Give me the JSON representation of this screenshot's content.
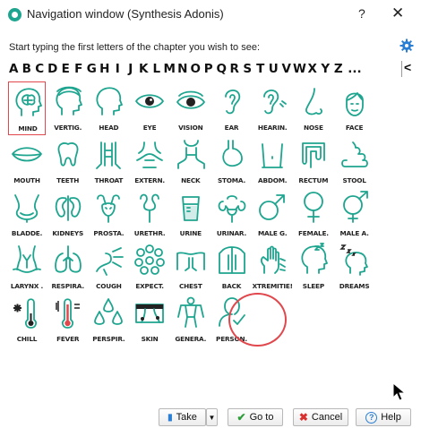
{
  "window": {
    "title": "Navigation window (Synthesis Adonis)",
    "help_glyph": "?",
    "close_glyph": "✕"
  },
  "instruction": "Start typing the first letters of the chapter you wish to see:",
  "alphabet": [
    "A",
    "B",
    "C",
    "D",
    "E",
    "F",
    "G",
    "H",
    "I",
    "J",
    "K",
    "L",
    "M",
    "N",
    "O",
    "P",
    "Q",
    "R",
    "S",
    "T",
    "U",
    "V",
    "W",
    "X",
    "Y",
    "Z"
  ],
  "alphabet_more": "...",
  "alphabet_back": "<",
  "chapters": [
    {
      "label": "MIND",
      "icon": "brain-head-icon"
    },
    {
      "label": "VERTIG.",
      "icon": "vertigo-head-icon"
    },
    {
      "label": "HEAD",
      "icon": "head-icon"
    },
    {
      "label": "EYE",
      "icon": "eye-icon"
    },
    {
      "label": "VISION",
      "icon": "vision-eye-icon"
    },
    {
      "label": "EAR",
      "icon": "ear-icon"
    },
    {
      "label": "HEARIN.",
      "icon": "hearing-ear-icon"
    },
    {
      "label": "NOSE",
      "icon": "nose-icon"
    },
    {
      "label": "FACE",
      "icon": "face-icon"
    },
    {
      "label": "MOUTH",
      "icon": "mouth-icon"
    },
    {
      "label": "TEETH",
      "icon": "tooth-icon"
    },
    {
      "label": "THROAT",
      "icon": "throat-icon"
    },
    {
      "label": "EXTERN.",
      "icon": "external-throat-icon"
    },
    {
      "label": "NECK",
      "icon": "neck-icon"
    },
    {
      "label": "STOMA.",
      "icon": "stomach-icon"
    },
    {
      "label": "ABDOM.",
      "icon": "abdomen-icon"
    },
    {
      "label": "RECTUM",
      "icon": "rectum-icon"
    },
    {
      "label": "STOOL",
      "icon": "stool-icon"
    },
    {
      "label": "BLADDE.",
      "icon": "bladder-icon"
    },
    {
      "label": "KIDNEYS",
      "icon": "kidneys-icon"
    },
    {
      "label": "PROSTA.",
      "icon": "prostate-icon"
    },
    {
      "label": "URETHR.",
      "icon": "urethra-icon"
    },
    {
      "label": "URINE",
      "icon": "urine-cup-icon"
    },
    {
      "label": "URINAR.",
      "icon": "urinary-organs-icon"
    },
    {
      "label": "MALE G.",
      "icon": "male-symbol-icon"
    },
    {
      "label": "FEMALE.",
      "icon": "female-symbol-icon"
    },
    {
      "label": "MALE A.",
      "icon": "male-female-symbol-icon"
    },
    {
      "label": "LARYNX .",
      "icon": "larynx-icon"
    },
    {
      "label": "RESPIRA.",
      "icon": "lungs-icon"
    },
    {
      "label": "COUGH",
      "icon": "cough-icon"
    },
    {
      "label": "EXPECT.",
      "icon": "expectoration-icon"
    },
    {
      "label": "CHEST",
      "icon": "chest-icon"
    },
    {
      "label": "BACK",
      "icon": "back-icon"
    },
    {
      "label": "XTREMITIE!",
      "icon": "extremities-hand-icon"
    },
    {
      "label": "SLEEP",
      "icon": "sleep-head-icon"
    },
    {
      "label": "DREAMS",
      "icon": "dreams-head-icon"
    },
    {
      "label": "CHILL",
      "icon": "chill-thermometer-icon"
    },
    {
      "label": "FEVER",
      "icon": "fever-thermometer-icon"
    },
    {
      "label": "PERSPIR.",
      "icon": "perspiration-drops-icon"
    },
    {
      "label": "SKIN",
      "icon": "skin-icon"
    },
    {
      "label": "GENERA.",
      "icon": "general-body-icon"
    },
    {
      "label": "PERSON.",
      "icon": "person-check-icon"
    }
  ],
  "footer": {
    "take_label": "Take",
    "goto_label": "Go to",
    "cancel_label": "Cancel",
    "help_label": "Help"
  },
  "colors": {
    "icon_teal": "#1ea58f",
    "selection_red": "#e0484d"
  }
}
